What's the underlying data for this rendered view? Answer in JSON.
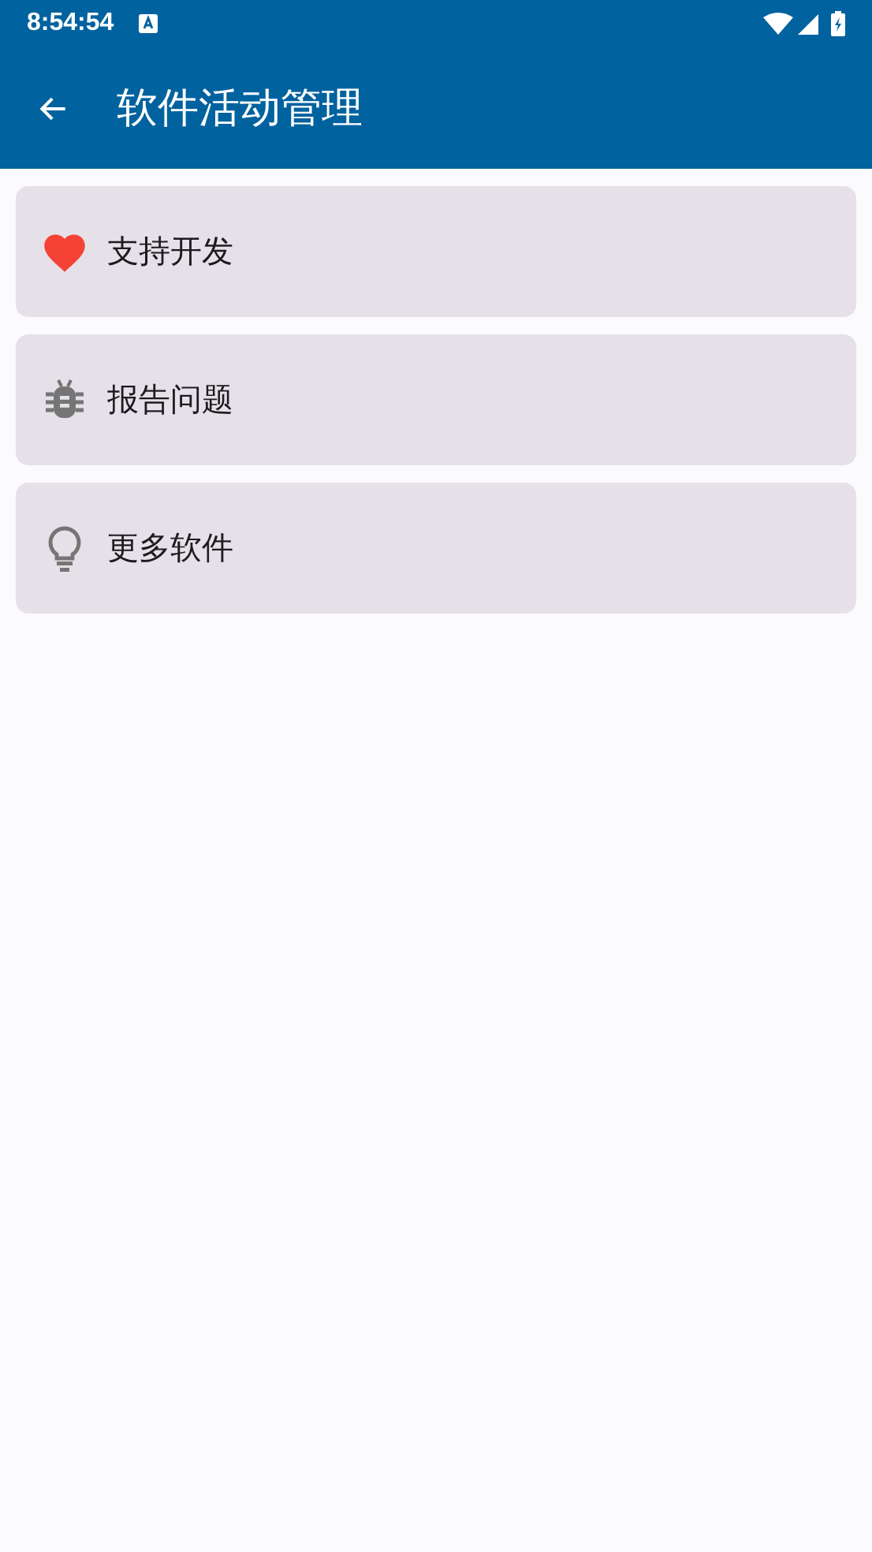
{
  "status_bar": {
    "time": "8:54:54"
  },
  "app_bar": {
    "title": "软件活动管理"
  },
  "items": [
    {
      "kind": "heart",
      "label": "支持开发"
    },
    {
      "kind": "bug",
      "label": "报告问题"
    },
    {
      "kind": "bulb",
      "label": "更多软件"
    }
  ]
}
